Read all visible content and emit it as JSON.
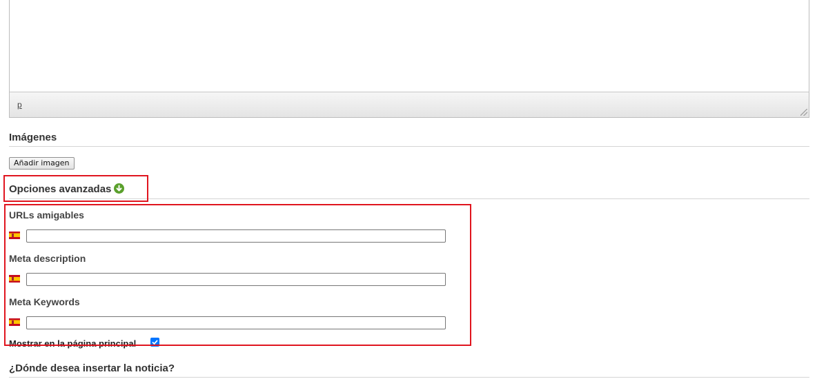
{
  "editor": {
    "status_path": "p"
  },
  "images_section": {
    "title": "Imágenes",
    "add_button": "Añadir imagen"
  },
  "advanced": {
    "title": "Opciones avanzadas",
    "expand_icon": "plus-circle-icon",
    "highlight_color": "#e0141e",
    "fields": [
      {
        "label": "URLs amigables",
        "flag": "spain-flag-icon",
        "value": ""
      },
      {
        "label": "Meta description",
        "flag": "spain-flag-icon",
        "value": ""
      },
      {
        "label": "Meta Keywords",
        "flag": "spain-flag-icon",
        "value": ""
      }
    ],
    "show_on_home": {
      "label": "Mostrar en la página principal",
      "checked": true
    }
  },
  "insert_section": {
    "title": "¿Dónde desea insertar la noticia?"
  }
}
